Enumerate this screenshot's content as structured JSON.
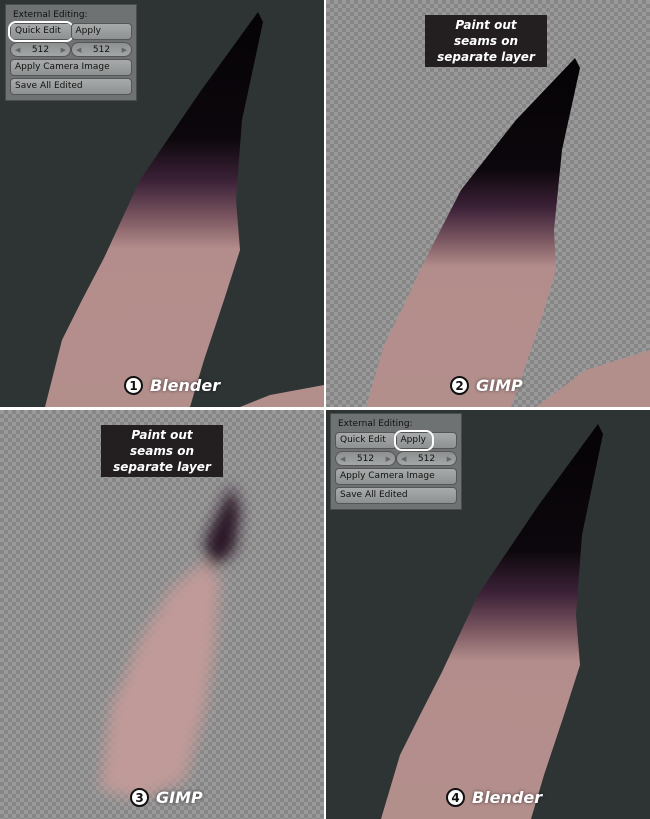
{
  "panels": [
    {
      "number": "1",
      "label": "Blender"
    },
    {
      "number": "2",
      "label": "GIMP",
      "note": "Paint out seams on separate layer"
    },
    {
      "number": "3",
      "label": "GIMP",
      "note": "Paint out seams on separate layer"
    },
    {
      "number": "4",
      "label": "Blender"
    }
  ],
  "blender_panel": {
    "header": "External Editing:",
    "quick_edit": "Quick Edit",
    "apply": "Apply",
    "width": "512",
    "height": "512",
    "apply_camera_image": "Apply Camera Image",
    "save_all_edited": "Save All Edited"
  },
  "colors": {
    "background_dark": "#2e3434",
    "highlight_ring": "#ffffff",
    "note_bg": "#231f20"
  }
}
